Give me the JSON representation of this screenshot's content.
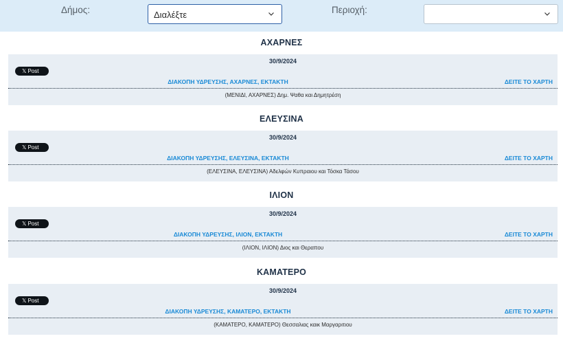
{
  "filters": {
    "dimos_label": "Δήμος:",
    "dimos_value": "Διαλέξτε",
    "perioxi_label": "Περιοχή:",
    "perioxi_value": ""
  },
  "post_button_label": "Post",
  "map_link_label": "ΔΕΙΤΕ ΤΟ ΧΑΡΤΗ",
  "sections": [
    {
      "title": "ΑΧΑΡΝΕΣ",
      "date": "30/9/2024",
      "link": "ΔΙΑΚΟΠΗ ΥΔΡΕΥΣΗΣ, ΑΧΑΡΝΕΣ, ΕΚΤΑΚΤΗ",
      "description": "(ΜΕΝΙΔΙ, ΑΧΑΡΝΕΣ) Δημ. Ψαθα και Δημητρέση"
    },
    {
      "title": "ΕΛΕΥΣΙΝΑ",
      "date": "30/9/2024",
      "link": "ΔΙΑΚΟΠΗ ΥΔΡΕΥΣΗΣ, ΕΛΕΥΣΙΝΑ, ΕΚΤΑΚΤΗ",
      "description": "(ΕΛΕΥΣΙΝΑ, ΕΛΕΥΣΙΝΑ) Αδελφών Κυπραιου και Τόσκα Τάσου"
    },
    {
      "title": "ΙΛΙΟΝ",
      "date": "30/9/2024",
      "link": "ΔΙΑΚΟΠΗ ΥΔΡΕΥΣΗΣ, ΙΛΙΟΝ, ΕΚΤΑΚΤΗ",
      "description": "(ΙΛΙΟΝ, ΙΛΙΟΝ) Διος και Θεραπου"
    },
    {
      "title": "ΚΑΜΑΤΕΡΟ",
      "date": "30/9/2024",
      "link": "ΔΙΑΚΟΠΗ ΥΔΡΕΥΣΗΣ, ΚΑΜΑΤΕΡΟ, ΕΚΤΑΚΤΗ",
      "description": "(ΚΑΜΑΤΕΡΟ, ΚΑΜΑΤΕΡΟ) Θεσσαλιας καικ Μαργαριτιου"
    }
  ]
}
